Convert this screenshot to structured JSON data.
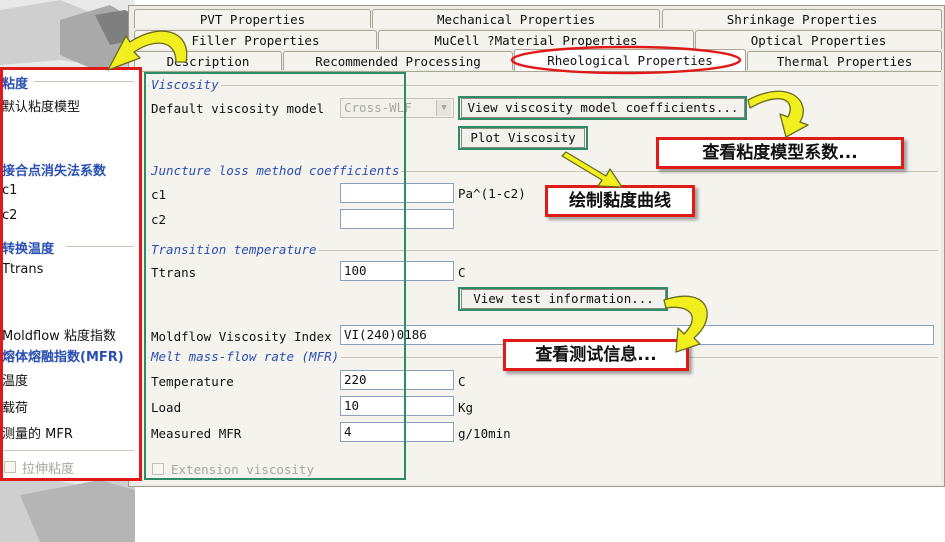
{
  "tabs_row1": [
    "PVT Properties",
    "Mechanical Properties",
    "Shrinkage Properties"
  ],
  "tabs_row2": [
    "Filler Properties",
    "MuCell ?Material Properties",
    "Optical Properties"
  ],
  "tabs_row3": [
    "Description",
    "Recommended Processing",
    "Rheological Properties",
    "Thermal Properties"
  ],
  "viscosity": {
    "title": "Viscosity",
    "model_label": "Default viscosity model",
    "model_value": "Cross-WLF",
    "view_coeff_button": "View viscosity model coefficients...",
    "plot_button": "Plot Viscosity"
  },
  "juncture": {
    "title": "Juncture loss method coefficients",
    "c1_label": "c1",
    "c1_unit": "Pa^(1-c2)",
    "c2_label": "c2"
  },
  "transition": {
    "title": "Transition temperature",
    "ttrans_label": "Ttrans",
    "ttrans_value": "100",
    "ttrans_unit": "C",
    "view_test_button": "View test information..."
  },
  "moldflow_index": {
    "label": "Moldflow Viscosity Index",
    "value": "VI(240)0186"
  },
  "mfr": {
    "title": "Melt mass-flow rate (MFR)",
    "temperature_label": "Temperature",
    "temperature_value": "220",
    "temperature_unit": "C",
    "load_label": "Load",
    "load_value": "10",
    "load_unit": "Kg",
    "measured_label": "Measured MFR",
    "measured_value": "4",
    "measured_unit": "g/10min"
  },
  "extension_label": "Extension viscosity",
  "left_translation": {
    "viscosity_head": "粘度",
    "default_model": "默认粘度模型",
    "juncture_head": "接合点消失法系数",
    "c1": "c1",
    "c2": "c2",
    "transition_head": "转换温度",
    "ttrans": "Ttrans",
    "moldflow_index": "Moldflow 粘度指数",
    "mfr_head": "熔体熔融指数(MFR)",
    "temperature": "温度",
    "load": "载荷",
    "measured": "测量的 MFR",
    "extension": "拉伸粘度"
  },
  "callouts": {
    "view_coeff": "查看粘度模型系数...",
    "plot": "绘制黏度曲线",
    "test_info": "查看测试信息..."
  },
  "colors": {
    "green_frame": "#2f8a68",
    "red_frame": "#e01919",
    "arrow_fill": "#f2ef1e",
    "group_title_blue": "#2a4fb3"
  }
}
